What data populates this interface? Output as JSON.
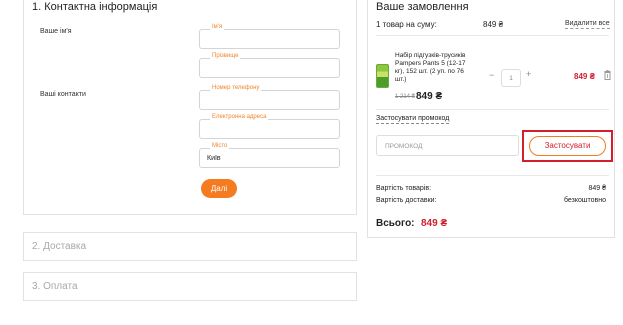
{
  "contact": {
    "title": "1. Контактна інформація",
    "name_label": "Ваше ім'я",
    "contacts_label": "Ваші контакти",
    "fields": {
      "first_name": {
        "label": "Ім'я",
        "value": ""
      },
      "last_name": {
        "label": "Прізвище",
        "value": ""
      },
      "phone": {
        "label": "Номер телефону",
        "value": ""
      },
      "email": {
        "label": "Електронна адреса",
        "value": ""
      },
      "city": {
        "label": "Місто",
        "value": "Київ"
      }
    },
    "next_button": "Далі"
  },
  "delivery": {
    "title": "2. Доставка"
  },
  "payment": {
    "title": "3. Оплата"
  },
  "order": {
    "title": "Ваше замовлення",
    "summary_label": "1 товар на суму:",
    "summary_price": "849 ₴",
    "remove_all": "Видалити все",
    "item": {
      "name": "Набір підгузків-трусиків Pampers Pants 5 (12-17 кг), 152 шт. (2 уп. по 76 шт.)",
      "old_price": "1 214 ₴",
      "new_price": "849 ₴",
      "quantity": "1",
      "minus": "−",
      "plus": "+",
      "line_price": "849 ₴"
    },
    "promo": {
      "link": "Застосувати промокод",
      "placeholder": "ПРОМОКОД",
      "apply_button": "Застосувати"
    },
    "goods_cost_label": "Вартість товарів:",
    "goods_cost_value": "849 ₴",
    "delivery_cost_label": "Вартість доставки:",
    "delivery_cost_value": "безкоштовно",
    "total_label": "Всього:",
    "total_value": "849 ₴"
  },
  "colors": {
    "accent": "#f47b20",
    "price_red": "#d0202f",
    "highlight": "#d11f2b"
  }
}
